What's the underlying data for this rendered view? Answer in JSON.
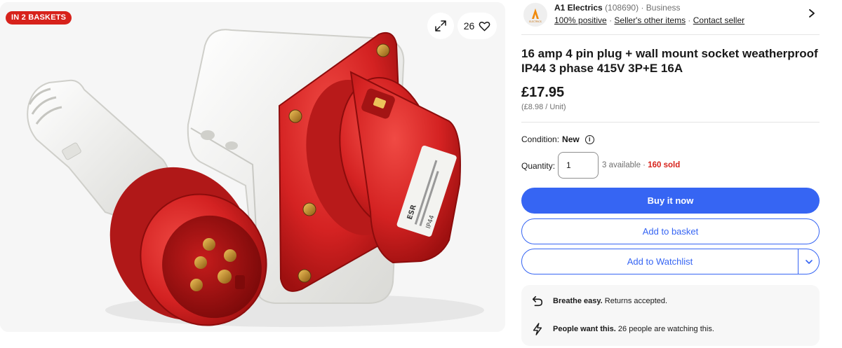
{
  "gallery": {
    "badge": "IN 2 BASKETS",
    "watch_count": "26",
    "icons": {
      "expand": "expand-icon",
      "watch": "heart-icon"
    },
    "product_markings": {
      "plug_brand": "ESR",
      "rating": "IP44"
    }
  },
  "seller": {
    "logo_text": "ELECTRICS",
    "name": "A1 Electrics",
    "feedback_count": "(108690)",
    "separator": "·",
    "type": "Business",
    "positive": "100% positive",
    "other_items": "Seller's other items",
    "contact": "Contact seller"
  },
  "listing": {
    "title": "16 amp 4 pin plug + wall mount socket weatherproof IP44 3 phase 415V 3P+E 16A",
    "price": "£17.95",
    "unit_price": "(£8.98 / Unit)",
    "condition_label": "Condition:",
    "condition_value": "New",
    "quantity_label": "Quantity:",
    "quantity_value": "1",
    "available": "3 available",
    "avail_separator": " · ",
    "sold": "160 sold"
  },
  "buttons": {
    "buy_now": "Buy it now",
    "add_basket": "Add to basket",
    "add_watchlist": "Add to Watchlist"
  },
  "highlights": [
    {
      "icon": "return-icon",
      "title": "Breathe easy.",
      "text": "Returns accepted."
    },
    {
      "icon": "lightning-icon",
      "title": "People want this.",
      "text": "26 people are watching this."
    }
  ],
  "colors": {
    "accent_blue": "#3665f3",
    "badge_red": "#d7221b",
    "product_red": "#d62828",
    "product_white": "#eeeeea"
  }
}
